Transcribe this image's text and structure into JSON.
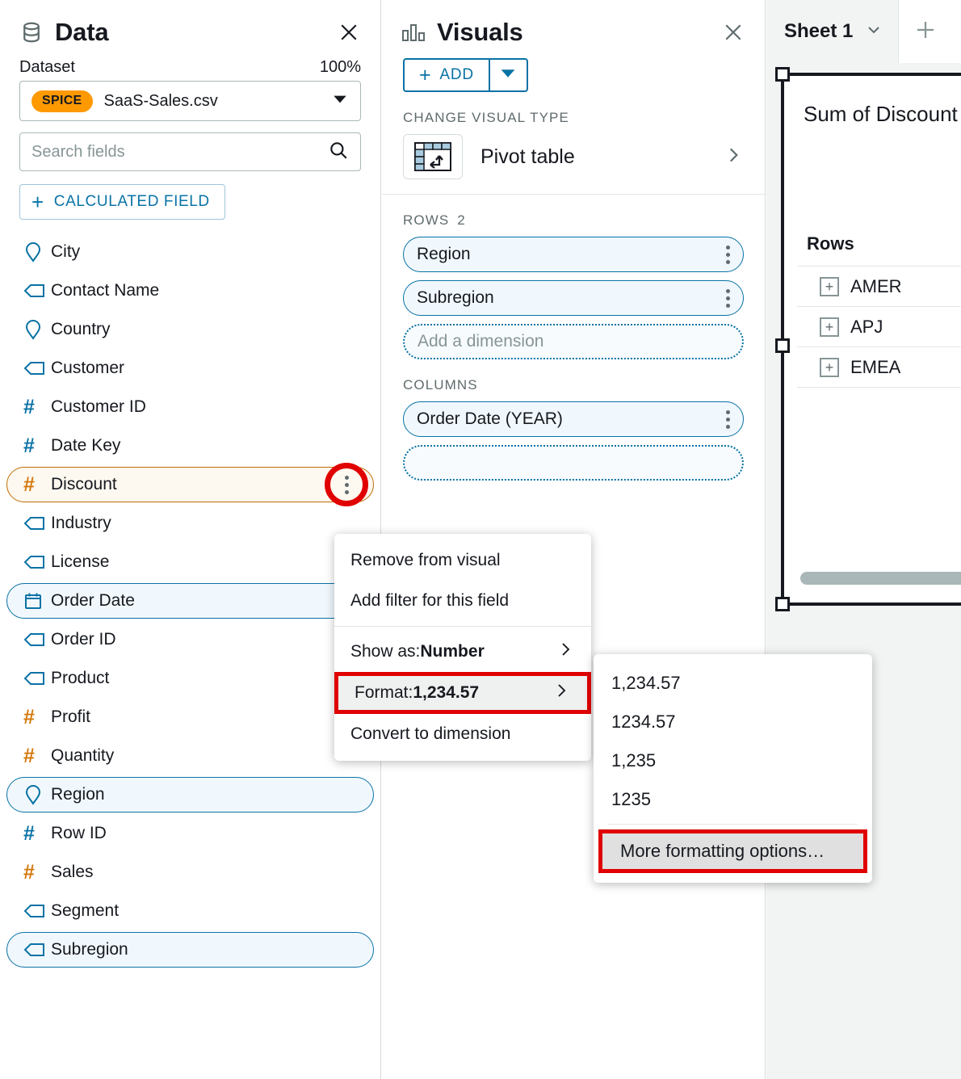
{
  "data_panel": {
    "title": "Data",
    "icon": "database-icon",
    "close_icon": "close-icon",
    "dataset_label": "Dataset",
    "dataset_percent": "100%",
    "dataset_badge": "SPICE",
    "dataset_name": "SaaS-Sales.csv",
    "search_placeholder": "Search fields",
    "search_value": "",
    "calculated_field_label": "CALCULATED FIELD",
    "fields": [
      {
        "name": "City",
        "icon": "geo-pin-icon",
        "type": "geo",
        "state": "normal"
      },
      {
        "name": "Contact Name",
        "icon": "string-tag-icon",
        "type": "string",
        "state": "normal"
      },
      {
        "name": "Country",
        "icon": "geo-pin-icon",
        "type": "geo",
        "state": "normal"
      },
      {
        "name": "Customer",
        "icon": "string-tag-icon",
        "type": "string",
        "state": "normal"
      },
      {
        "name": "Customer ID",
        "icon": "hash-icon",
        "type": "number-blue",
        "state": "normal"
      },
      {
        "name": "Date Key",
        "icon": "hash-icon",
        "type": "number-blue",
        "state": "normal"
      },
      {
        "name": "Discount",
        "icon": "hash-icon",
        "type": "number-orange",
        "state": "selected-orange",
        "menu_open": true
      },
      {
        "name": "Industry",
        "icon": "string-tag-icon",
        "type": "string",
        "state": "normal"
      },
      {
        "name": "License",
        "icon": "string-tag-icon",
        "type": "string",
        "state": "normal"
      },
      {
        "name": "Order Date",
        "icon": "calendar-icon",
        "type": "date",
        "state": "selected-blue"
      },
      {
        "name": "Order ID",
        "icon": "string-tag-icon",
        "type": "string",
        "state": "normal"
      },
      {
        "name": "Product",
        "icon": "string-tag-icon",
        "type": "string",
        "state": "normal"
      },
      {
        "name": "Profit",
        "icon": "hash-icon",
        "type": "number-orange",
        "state": "normal"
      },
      {
        "name": "Quantity",
        "icon": "hash-icon",
        "type": "number-orange",
        "state": "normal"
      },
      {
        "name": "Region",
        "icon": "geo-pin-icon",
        "type": "geo",
        "state": "selected-blue"
      },
      {
        "name": "Row ID",
        "icon": "hash-icon",
        "type": "number-blue",
        "state": "normal"
      },
      {
        "name": "Sales",
        "icon": "hash-icon",
        "type": "number-orange",
        "state": "normal"
      },
      {
        "name": "Segment",
        "icon": "string-tag-icon",
        "type": "string",
        "state": "normal"
      },
      {
        "name": "Subregion",
        "icon": "string-tag-icon",
        "type": "string",
        "state": "selected-blue"
      }
    ]
  },
  "visuals_panel": {
    "title": "Visuals",
    "icon": "bar-chart-icon",
    "close_icon": "close-icon",
    "add_label": "ADD",
    "add_caret_icon": "caret-down-icon",
    "change_visual_type_label": "CHANGE VISUAL TYPE",
    "visual_type_name": "Pivot table",
    "visual_type_icon": "pivot-table-icon",
    "rows_label": "ROWS",
    "rows_count": "2",
    "rows_fields": [
      "Region",
      "Subregion"
    ],
    "rows_placeholder": "Add a dimension",
    "columns_label": "COLUMNS",
    "columns_fields": [
      "Order Date (YEAR)"
    ]
  },
  "canvas": {
    "sheet_tab": "Sheet 1",
    "sheet_chevron_icon": "chevron-down-icon",
    "add_sheet_icon": "plus-icon",
    "visual_title": "Sum of Discount",
    "rows_header": "Rows",
    "pivot_rows": [
      "AMER",
      "APJ",
      "EMEA"
    ],
    "expand_icon": "plus-square-icon"
  },
  "context_menu": {
    "items": [
      {
        "label": "Remove from visual",
        "chevron": false,
        "highlighted": false
      },
      {
        "label": "Add filter for this field",
        "chevron": false,
        "highlighted": false
      }
    ],
    "show_as_prefix": "Show as: ",
    "show_as_value": "Number",
    "format_prefix": "Format: ",
    "format_value": "1,234.57",
    "convert_label": "Convert to dimension"
  },
  "format_submenu": {
    "options": [
      "1,234.57",
      "1234.57",
      "1,235",
      "1235"
    ],
    "more_label": "More formatting options…"
  },
  "colors": {
    "accent_blue": "#0972a5",
    "accent_orange": "#d4780a",
    "spice_orange": "#ff9900",
    "highlight_red": "#e00000",
    "selected_orange_border": "#bf6e00"
  }
}
